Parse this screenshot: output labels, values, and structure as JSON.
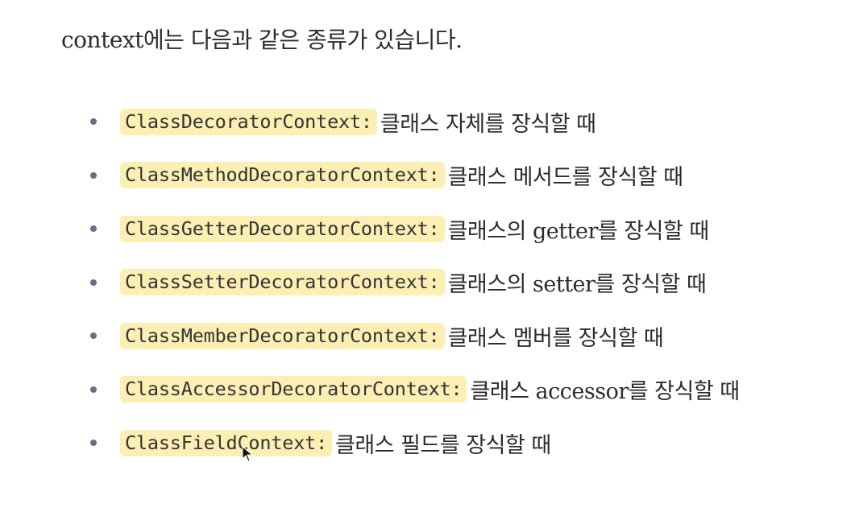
{
  "intro": "context에는 다음과 같은 종류가 있습니다.",
  "items": [
    {
      "code": "ClassDecoratorContext:",
      "desc": "클래스 자체를 장식할 때"
    },
    {
      "code": "ClassMethodDecoratorContext:",
      "desc": "클래스 메서드를 장식할 때"
    },
    {
      "code": "ClassGetterDecoratorContext:",
      "desc": "클래스의 getter를 장식할 때"
    },
    {
      "code": "ClassSetterDecoratorContext:",
      "desc": "클래스의 setter를 장식할 때"
    },
    {
      "code": "ClassMemberDecoratorContext:",
      "desc": "클래스 멤버를 장식할 때"
    },
    {
      "code": "ClassAccessorDecoratorContext:",
      "desc": "클래스 accessor를 장식할 때"
    },
    {
      "code": "ClassFieldContext:",
      "desc": "클래스 필드를 장식할 때"
    }
  ],
  "colors": {
    "highlight": "#fbefb4",
    "bullet": "#6f6a86",
    "text": "#2b2b2b"
  },
  "icons": {
    "cursor": "mouse-pointer-icon"
  }
}
